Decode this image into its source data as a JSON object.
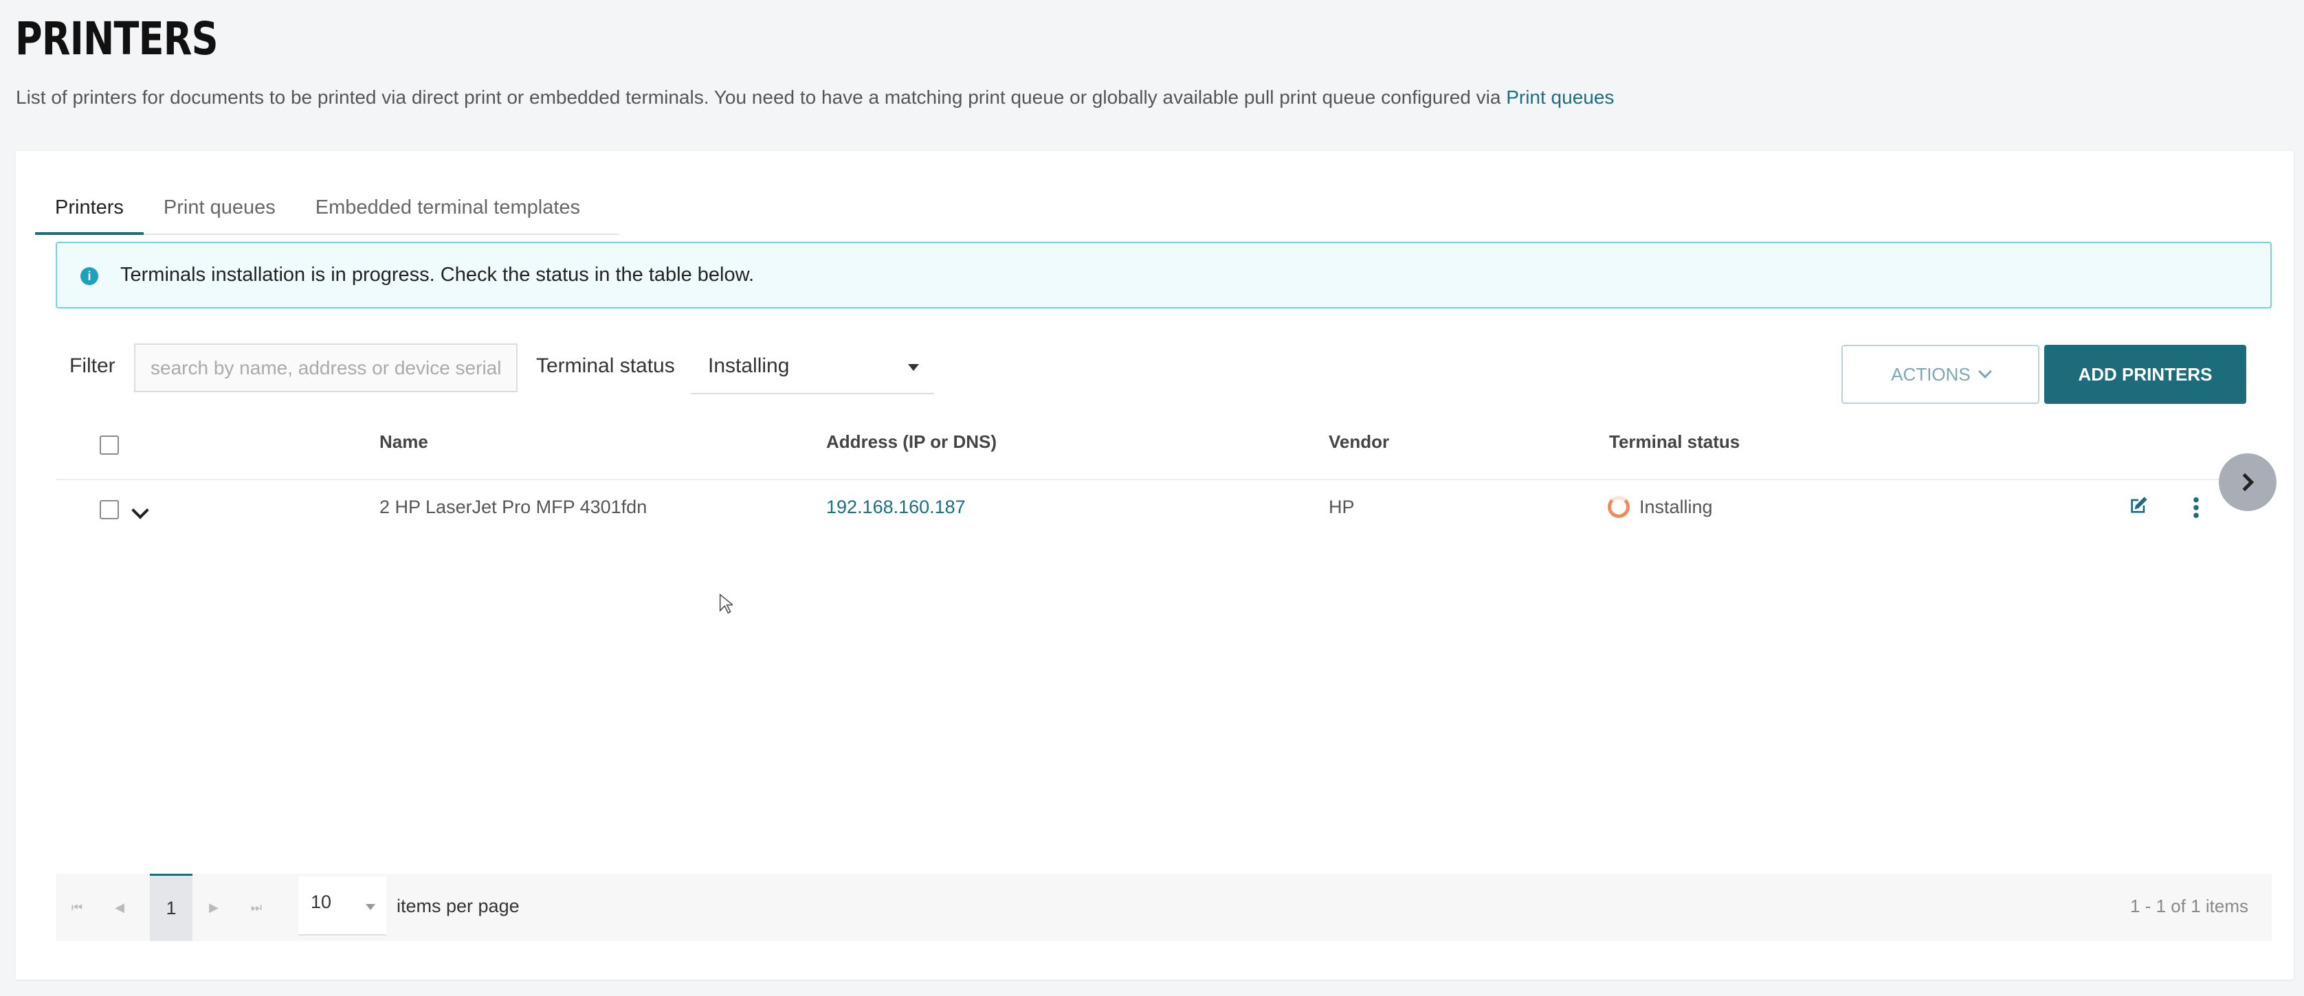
{
  "page": {
    "title": "PRINTERS",
    "description": "List of printers for documents to be printed via direct print or embedded terminals. You need to have a matching print queue or globally available pull print queue configured via ",
    "description_link": "Print queues"
  },
  "tabs": [
    {
      "label": "Printers",
      "active": true
    },
    {
      "label": "Print queues",
      "active": false
    },
    {
      "label": "Embedded terminal templates",
      "active": false
    }
  ],
  "banner": {
    "icon": "info-icon",
    "message": "Terminals installation is in progress. Check the status in the table below."
  },
  "filter": {
    "label": "Filter",
    "search_placeholder": "search by name, address or device serial",
    "search_value": "",
    "status_label": "Terminal status",
    "status_value": "Installing"
  },
  "toolbar": {
    "actions_label": "ACTIONS",
    "add_label": "ADD PRINTERS"
  },
  "table": {
    "columns": [
      "Name",
      "Address (IP or DNS)",
      "Vendor",
      "Terminal status"
    ],
    "rows": [
      {
        "name": "2 HP LaserJet Pro MFP 4301fdn",
        "address": "192.168.160.187",
        "vendor": "HP",
        "status": "Installing",
        "status_icon": "spinner-icon"
      }
    ]
  },
  "pager": {
    "current_page": "1",
    "page_size": "10",
    "page_size_label": "items per page",
    "info": "1 - 1 of 1 items"
  },
  "colors": {
    "accent": "#1c6c7b",
    "link": "#1a6e7d",
    "info_border": "#75d2df",
    "status_installing": "#f08a5b"
  }
}
